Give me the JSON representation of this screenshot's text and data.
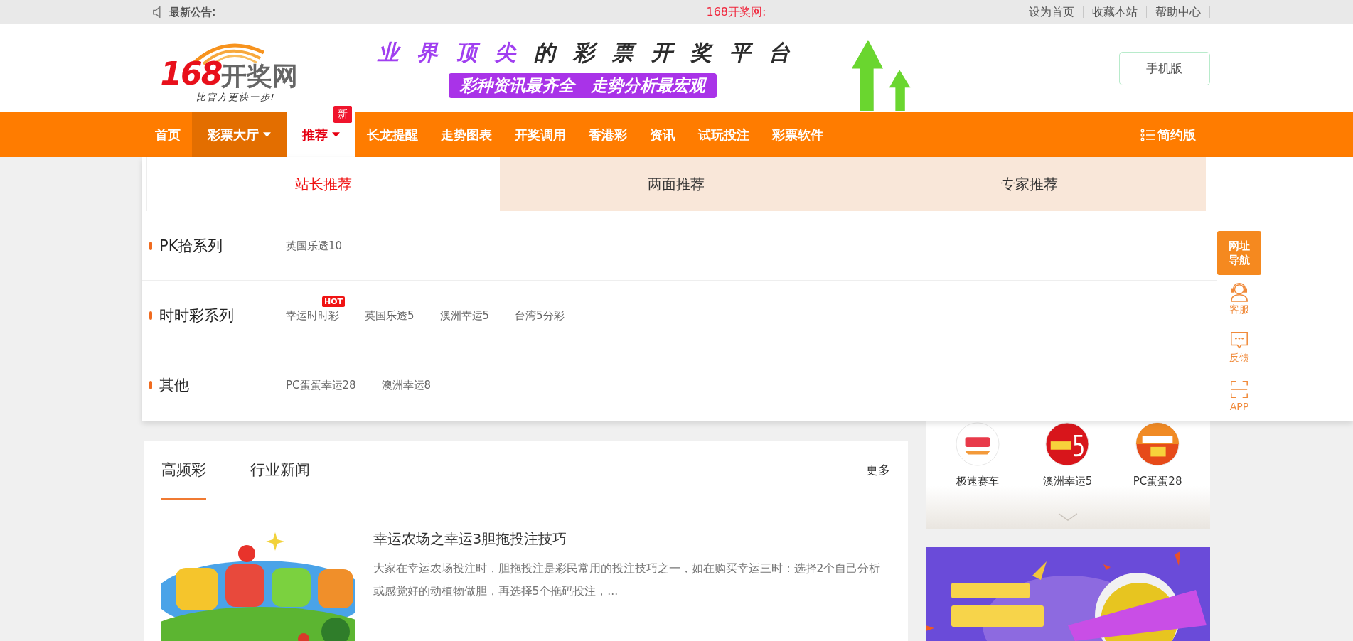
{
  "announcement_bar": {
    "label": "最新公告:",
    "site_notice": "168开奖网:",
    "links": [
      "设为首页",
      "收藏本站",
      "帮助中心"
    ]
  },
  "header": {
    "logo_number": "168",
    "logo_name": "开奖网",
    "logo_tagline": "比官方更快一步!",
    "slogan_highlight": "业界顶尖",
    "slogan_rest": "的彩票开奖平台",
    "slogan_sub": "彩种资讯最齐全　走势分析最宏观",
    "mobile_button": "手机版"
  },
  "nav": {
    "items": [
      {
        "label": "首页",
        "selected": false,
        "highlighted": false,
        "dropdown": false
      },
      {
        "label": "彩票大厅",
        "selected": false,
        "highlighted": true,
        "dropdown": true
      },
      {
        "label": "推荐",
        "selected": true,
        "highlighted": false,
        "dropdown": true,
        "badge": "新"
      },
      {
        "label": "长龙提醒",
        "selected": false,
        "highlighted": false,
        "dropdown": false
      },
      {
        "label": "走势图表",
        "selected": false,
        "highlighted": false,
        "dropdown": false
      },
      {
        "label": "开奖调用",
        "selected": false,
        "highlighted": false,
        "dropdown": false
      },
      {
        "label": "香港彩",
        "selected": false,
        "highlighted": false,
        "dropdown": false
      },
      {
        "label": "资讯",
        "selected": false,
        "highlighted": false,
        "dropdown": false
      },
      {
        "label": "试玩投注",
        "selected": false,
        "highlighted": false,
        "dropdown": false
      },
      {
        "label": "彩票软件",
        "selected": false,
        "highlighted": false,
        "dropdown": false
      }
    ],
    "simple_mode": "简约版"
  },
  "dropdown": {
    "tabs": [
      {
        "label": "站长推荐",
        "selected": true
      },
      {
        "label": "两面推荐",
        "selected": false
      },
      {
        "label": "专家推荐",
        "selected": false
      }
    ],
    "groups": [
      {
        "title": "PK拾系列",
        "links": [
          {
            "label": "英国乐透10"
          }
        ]
      },
      {
        "title": "时时彩系列",
        "links": [
          {
            "label": "幸运时时彩",
            "badge": "HOT"
          },
          {
            "label": "英国乐透5"
          },
          {
            "label": "澳洲幸运5"
          },
          {
            "label": "台湾5分彩"
          }
        ]
      },
      {
        "title": "其他",
        "links": [
          {
            "label": "PC蛋蛋幸运28"
          },
          {
            "label": "澳洲幸运8"
          }
        ]
      }
    ]
  },
  "side_toolbar": {
    "items": [
      {
        "kind": "nav",
        "label": "网址导航"
      },
      {
        "kind": "service",
        "label": "客服"
      },
      {
        "kind": "feedback",
        "label": "反馈"
      },
      {
        "kind": "app",
        "label": "APP"
      }
    ]
  },
  "news": {
    "tabs": [
      {
        "label": "高频彩",
        "selected": true
      },
      {
        "label": "行业新闻",
        "selected": false
      }
    ],
    "more": "更多",
    "articles": [
      {
        "title": "幸运农场之幸运3胆拖投注技巧",
        "summary": "大家在幸运农场投注时，胆拖投注是彩民常用的投注技巧之一，如在购买幸运三时：选择2个自己分析或感觉好的动植物做胆，再选择5个拖码投注，..."
      }
    ]
  },
  "lottery_panel": {
    "items": [
      {
        "kind": "racing",
        "name": "极速赛车"
      },
      {
        "kind": "lucky5",
        "name": "澳洲幸运5"
      },
      {
        "kind": "pc28",
        "name": "PC蛋蛋28"
      }
    ]
  }
}
